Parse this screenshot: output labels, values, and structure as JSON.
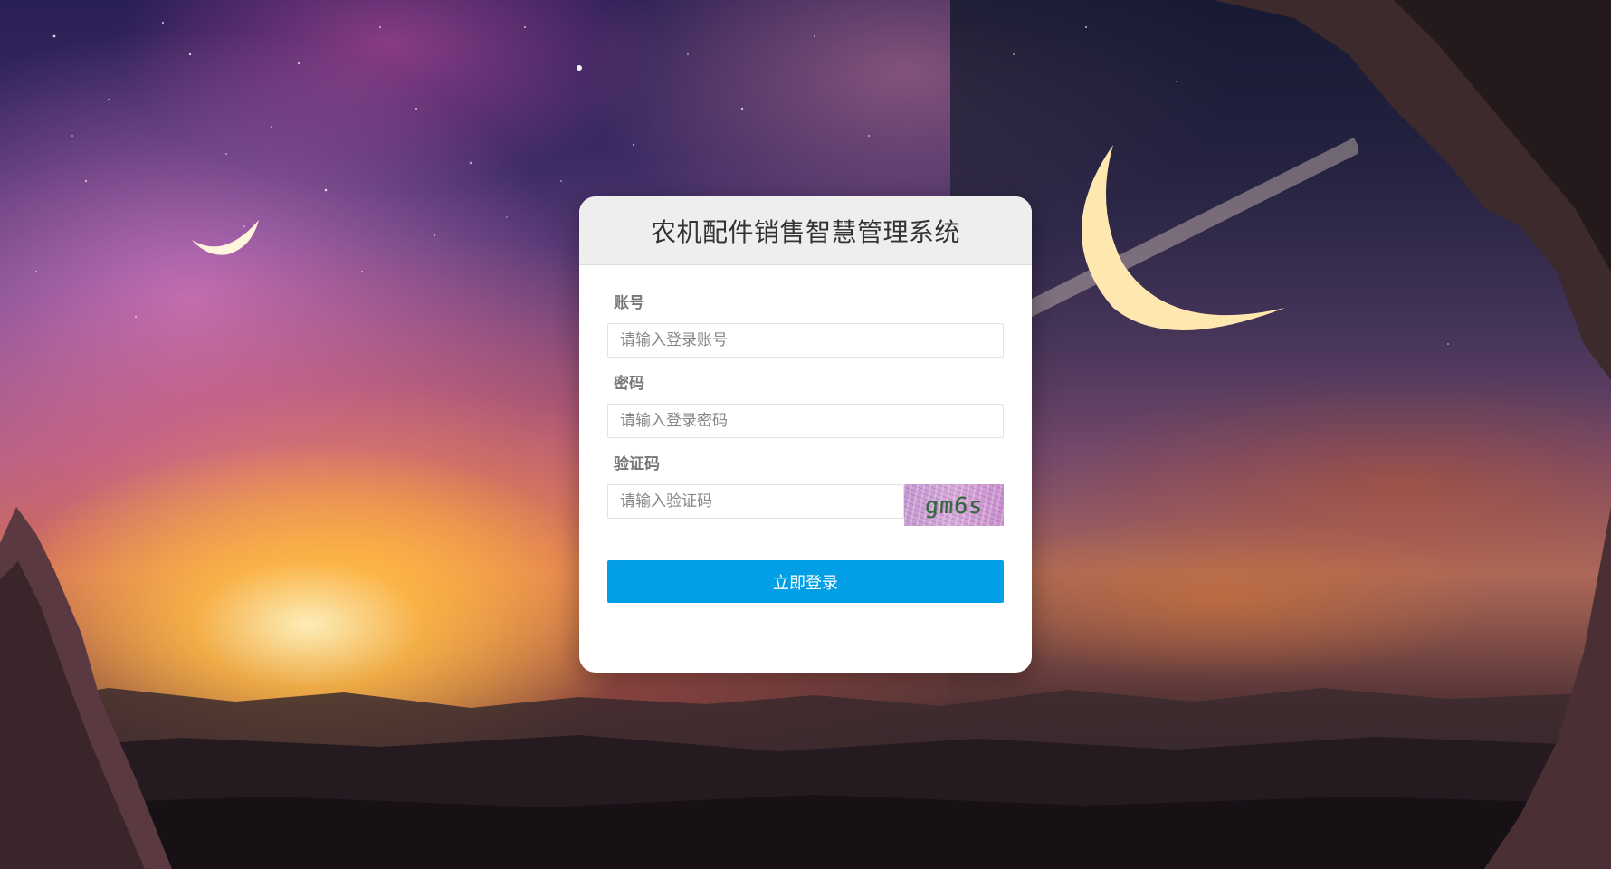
{
  "login": {
    "title": "农机配件销售智慧管理系统",
    "account": {
      "label": "账号",
      "placeholder": "请输入登录账号",
      "value": ""
    },
    "password": {
      "label": "密码",
      "placeholder": "请输入登录密码",
      "value": ""
    },
    "captcha": {
      "label": "验证码",
      "placeholder": "请输入验证码",
      "value": "",
      "image_text": "gm6s"
    },
    "submit_label": "立即登录"
  },
  "colors": {
    "primary_button": "#039fe6",
    "header_background": "#eeeeee",
    "card_background": "#ffffff"
  }
}
